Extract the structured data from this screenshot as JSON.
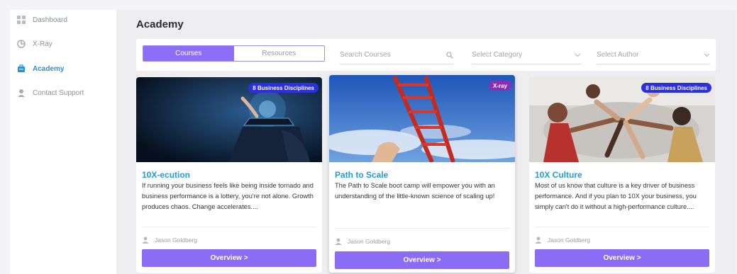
{
  "sidebar": {
    "items": [
      {
        "label": "Dashboard",
        "icon": "dashboard-icon",
        "active": false
      },
      {
        "label": "X-Ray",
        "icon": "xray-icon",
        "active": false
      },
      {
        "label": "Academy",
        "icon": "academy-icon",
        "active": true
      },
      {
        "label": "Contact Support",
        "icon": "support-icon",
        "active": false
      }
    ]
  },
  "page": {
    "title": "Academy"
  },
  "toolbar": {
    "tabs": [
      {
        "label": "Courses",
        "active": true
      },
      {
        "label": "Resources",
        "active": false
      }
    ],
    "search_placeholder": "Search Courses",
    "category_placeholder": "Select Category",
    "author_placeholder": "Select Author"
  },
  "courses": [
    {
      "badge": "8 Business Disciplines",
      "title": "10X-ecution",
      "description": "If running your business feels like being inside tornado and business performance is a lottery, you're not alone. Growth produces chaos. Change accelerates....",
      "author": "Jason Goldberg",
      "button": "Overview >"
    },
    {
      "badge": "X-ray",
      "title": "Path to Scale",
      "description": "The Path to Scale boot camp will empower you with an understanding of the little-known science of scaling up!",
      "author": "Jason Goldberg",
      "button": "Overview >"
    },
    {
      "badge": "8 Business Disciplines",
      "title": "10X Culture",
      "description": "Most of us know that culture is a key driver of business performance. And if you plan to 10X your business, you simply can't do it without a high-performance culture....",
      "author": "Jason Goldberg",
      "button": "Overview >"
    }
  ],
  "colors": {
    "accent": "#8b6cf4",
    "link": "#1f9be0",
    "badge_blue": "#2c2fe0",
    "badge_purple": "#8a2fb5"
  }
}
